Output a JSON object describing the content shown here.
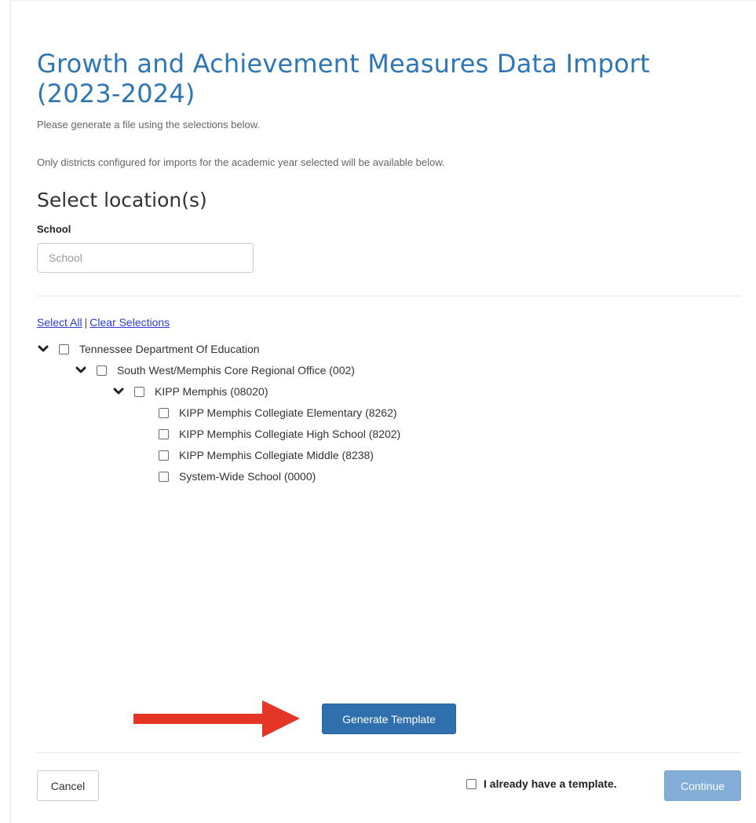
{
  "page": {
    "title": "Growth and Achievement Measures Data Import (2023-2024)",
    "intro_line_1": "Please generate a file using the selections below.",
    "intro_line_2": "Only districts configured for imports for the academic year selected will be available below."
  },
  "location": {
    "section_title": "Select location(s)",
    "field_label": "School",
    "search_placeholder": "School",
    "search_value": "",
    "select_all_label": "Select All",
    "separator": "|",
    "clear_label": "Clear Selections"
  },
  "tree": [
    {
      "label": "Tennessee Department Of Education",
      "expanded": true,
      "checked": false,
      "level": 0
    },
    {
      "label": "South West/Memphis Core Regional Office (002)",
      "expanded": true,
      "checked": false,
      "level": 1
    },
    {
      "label": "KIPP Memphis (08020)",
      "expanded": true,
      "checked": false,
      "level": 2
    },
    {
      "label": "KIPP Memphis Collegiate Elementary (8262)",
      "checked": false,
      "level": 3
    },
    {
      "label": "KIPP Memphis Collegiate High School (8202)",
      "checked": false,
      "level": 3
    },
    {
      "label": "KIPP Memphis Collegiate Middle (8238)",
      "checked": false,
      "level": 3
    },
    {
      "label": "System-Wide School (0000)",
      "checked": false,
      "level": 3
    }
  ],
  "actions": {
    "generate_label": "Generate Template",
    "cancel_label": "Cancel",
    "have_template_label": "I already have a template.",
    "have_template_checked": false,
    "continue_label": "Continue",
    "continue_enabled": false
  },
  "colors": {
    "title": "#2f76b5",
    "primary_button": "#2f6fad",
    "disabled_button": "#83acd6",
    "link": "#2a3fd1",
    "annotation_arrow": "#e53527"
  },
  "icons": {
    "tree_expand": "chevron-down-icon",
    "annotation": "red-arrow-right-icon"
  }
}
